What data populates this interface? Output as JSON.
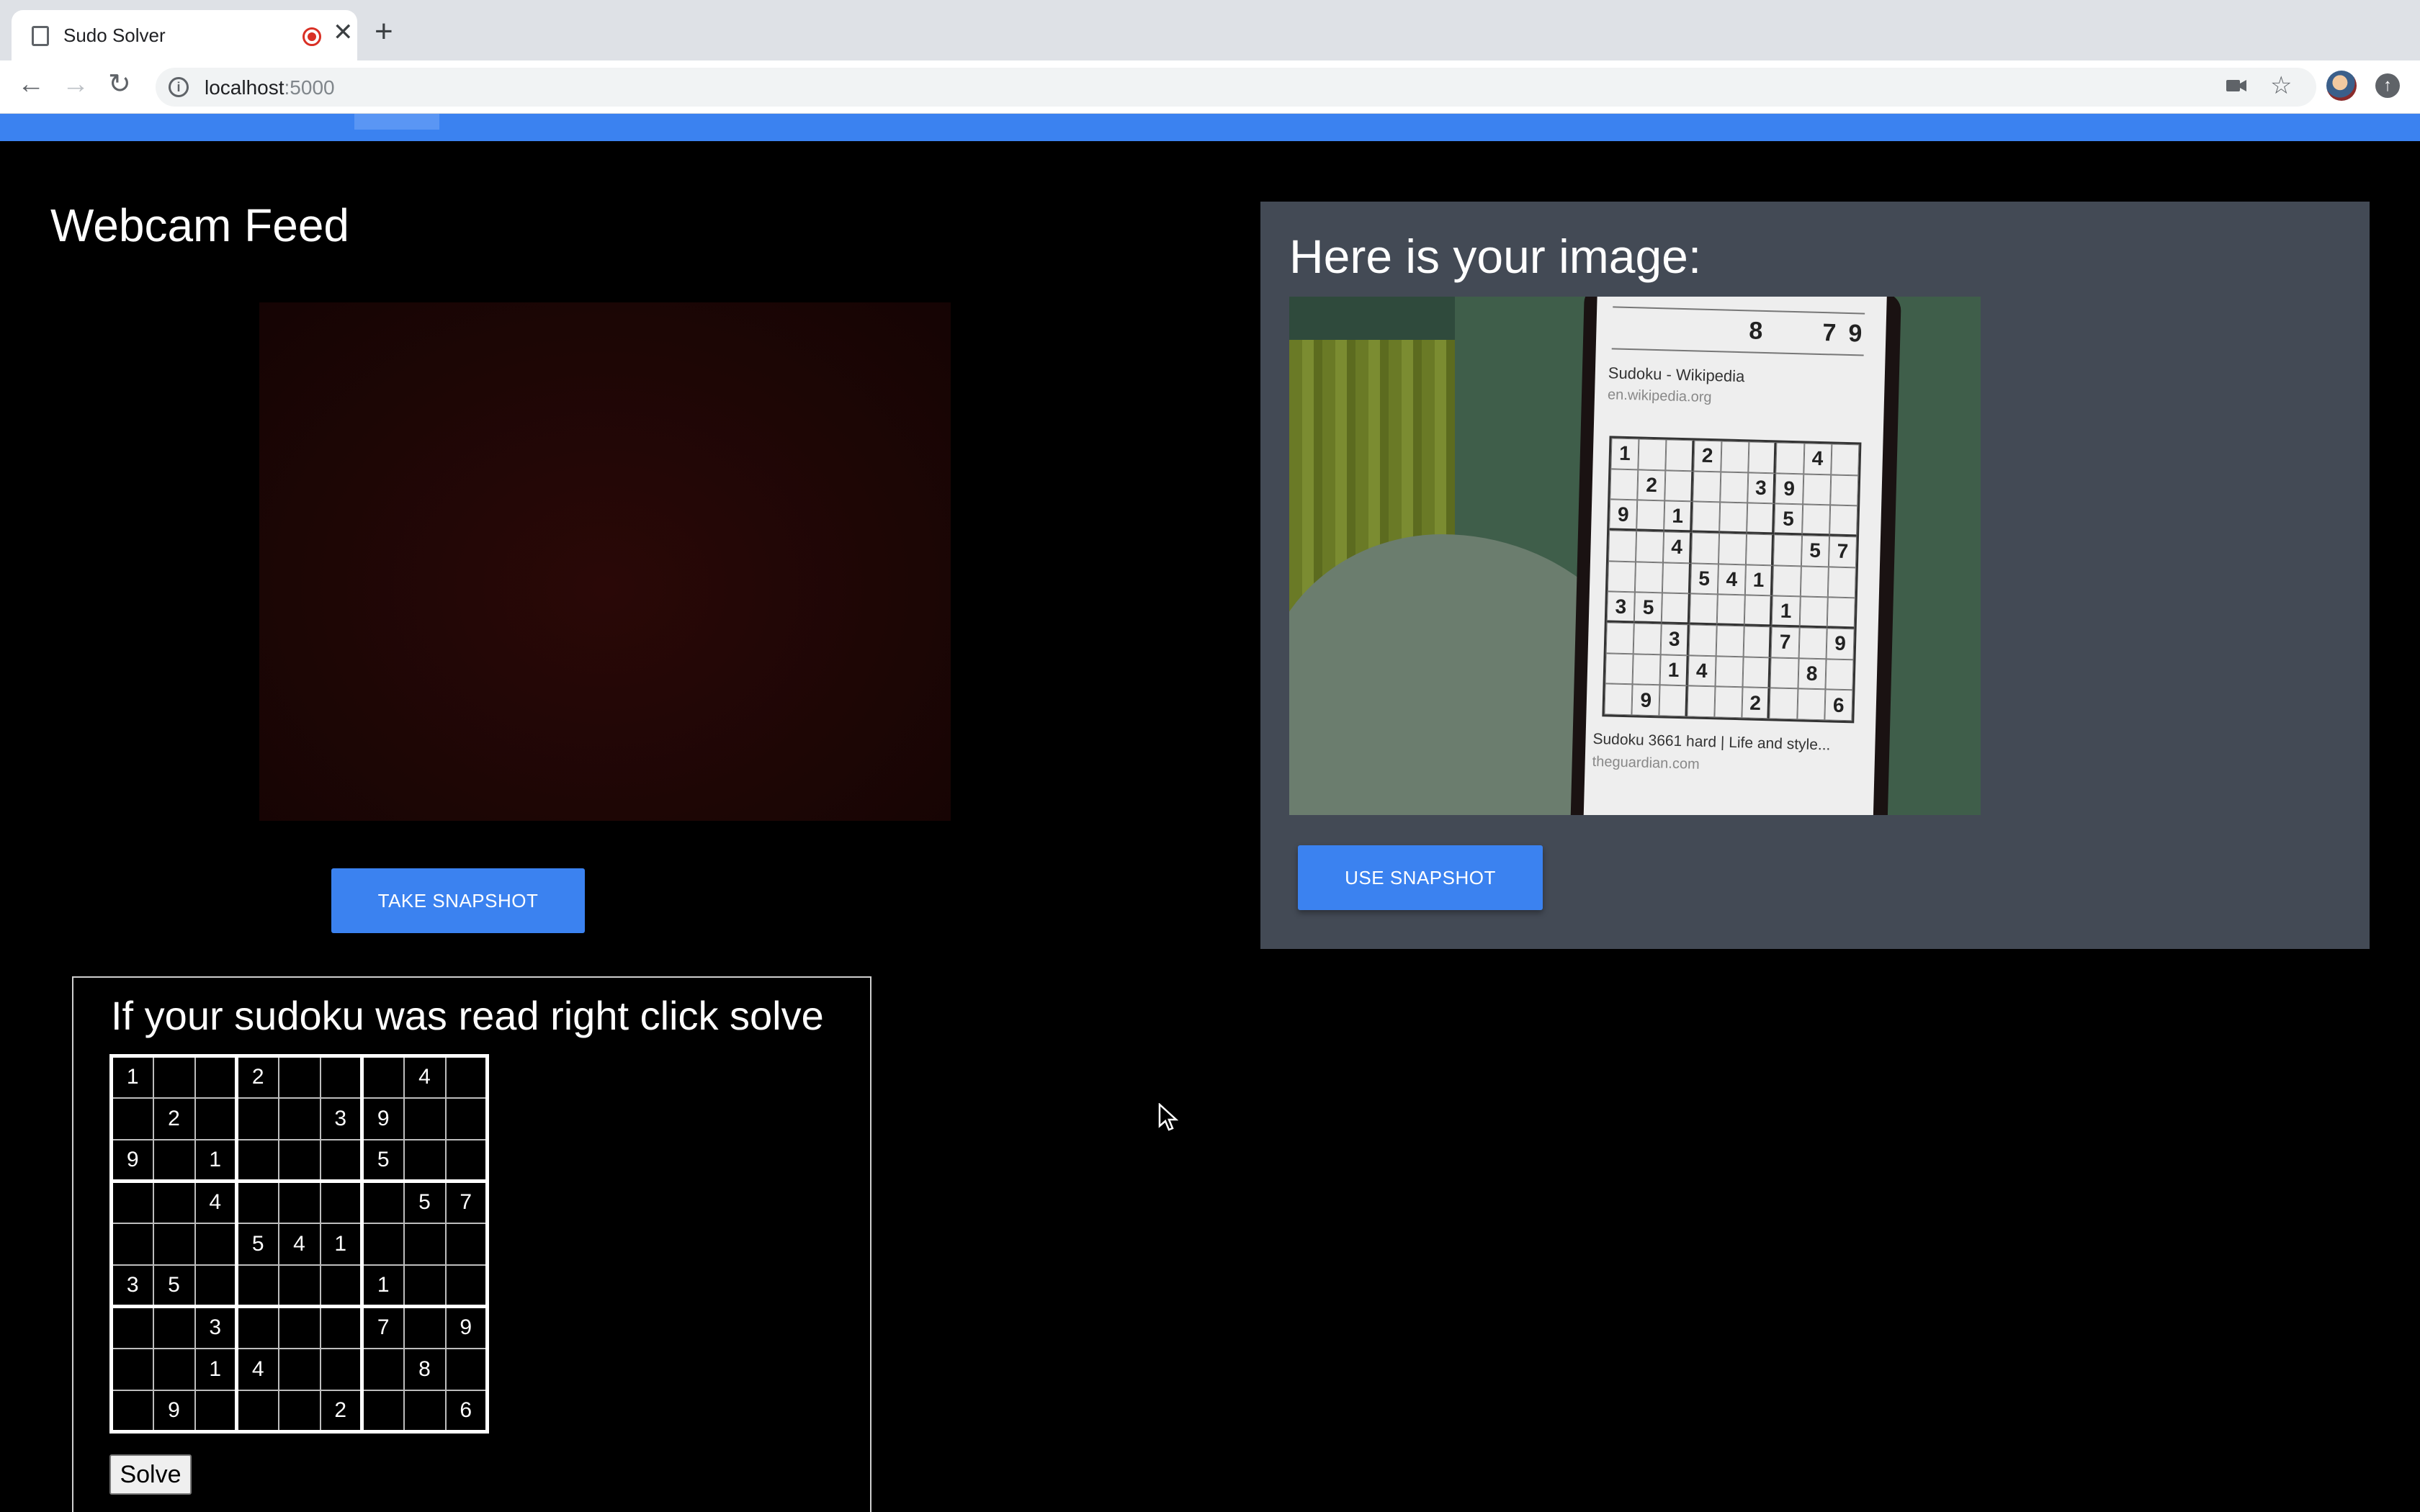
{
  "browser": {
    "tab_title": "Sudo Solver",
    "close_glyph": "✕",
    "new_tab_glyph": "+",
    "url_host": "localhost",
    "url_port": ":5000",
    "info_glyph": "i",
    "icons": [
      "back-icon",
      "forward-icon",
      "reload-icon",
      "camera-icon",
      "star-icon",
      "avatar",
      "update-icon"
    ]
  },
  "webcam": {
    "title": "Webcam Feed",
    "take_button": "TAKE SNAPSHOT"
  },
  "snapshot": {
    "title": "Here is your image:",
    "use_button": "USE SNAPSHOT",
    "photo_text": {
      "page_title": "Sudoku - Wikipedia",
      "page_url": "en.wikipedia.org",
      "caption": "Sudoku 3661 hard | Life and style...",
      "caption_source": "theguardian.com",
      "top_digits": [
        "8",
        "7",
        "9"
      ]
    }
  },
  "sudoku": {
    "title": "If your sudoku was read right click solve",
    "grid": [
      [
        "1",
        "",
        "",
        "2",
        "",
        "",
        "",
        "4",
        ""
      ],
      [
        "",
        "2",
        "",
        "",
        "",
        "3",
        "9",
        "",
        ""
      ],
      [
        "9",
        "",
        "1",
        "",
        "",
        "",
        "5",
        "",
        ""
      ],
      [
        "",
        "",
        "4",
        "",
        "",
        "",
        "",
        "5",
        "7"
      ],
      [
        "",
        "",
        "",
        "5",
        "4",
        "1",
        "",
        "",
        ""
      ],
      [
        "3",
        "5",
        "",
        "",
        "",
        "",
        "1",
        "",
        ""
      ],
      [
        "",
        "",
        "3",
        "",
        "",
        "",
        "7",
        "",
        "9"
      ],
      [
        "",
        "",
        "1",
        "4",
        "",
        "",
        "",
        "8",
        ""
      ],
      [
        "",
        "9",
        "",
        "",
        "",
        "2",
        "",
        "",
        "6"
      ]
    ],
    "solve_button": "Solve"
  },
  "colors": {
    "accent": "#3b82f0",
    "panel": "#434a55",
    "background": "#000000"
  }
}
